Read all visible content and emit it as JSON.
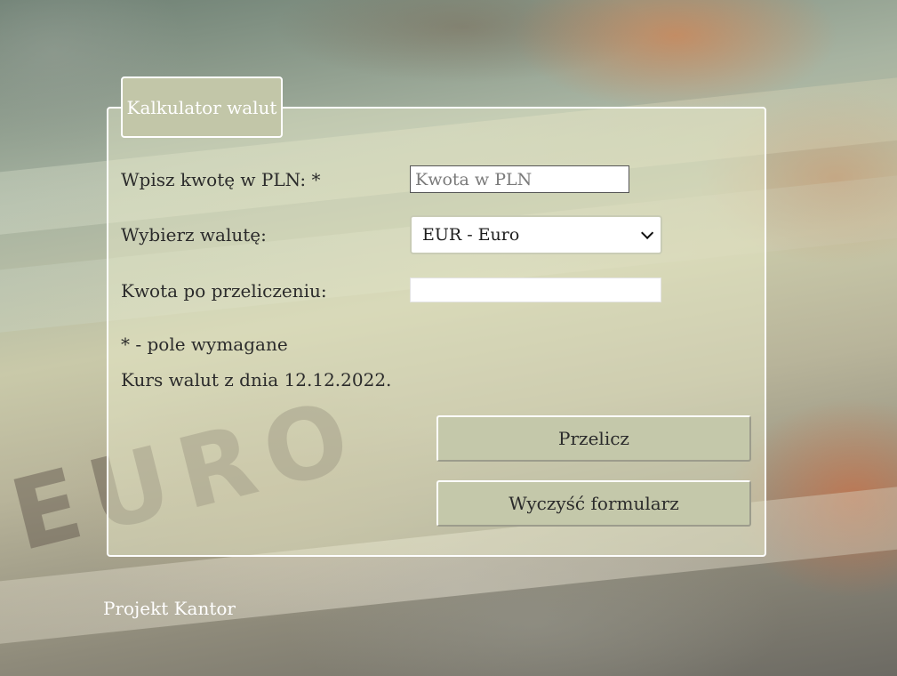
{
  "form": {
    "legend": "Kalkulator walut",
    "amount_label": "Wpisz kwotę w PLN: *",
    "amount_placeholder": "Kwota w PLN",
    "amount_value": "",
    "currency_label": "Wybierz walutę:",
    "currency_selected": "EUR - Euro",
    "result_label": "Kwota po przeliczeniu:",
    "result_value": "",
    "required_note": "* - pole wymagane",
    "rate_note": "Kurs walut z dnia 12.12.2022.",
    "calculate_button": "Przelicz",
    "clear_button": "Wyczyść formularz"
  },
  "footer": {
    "text": "Projekt Kantor"
  },
  "background": {
    "banknote_text": "EURO"
  },
  "colors": {
    "button_bg": "#c4c8aa",
    "legend_bg": "#c2c6a8",
    "border": "#ffffff"
  }
}
